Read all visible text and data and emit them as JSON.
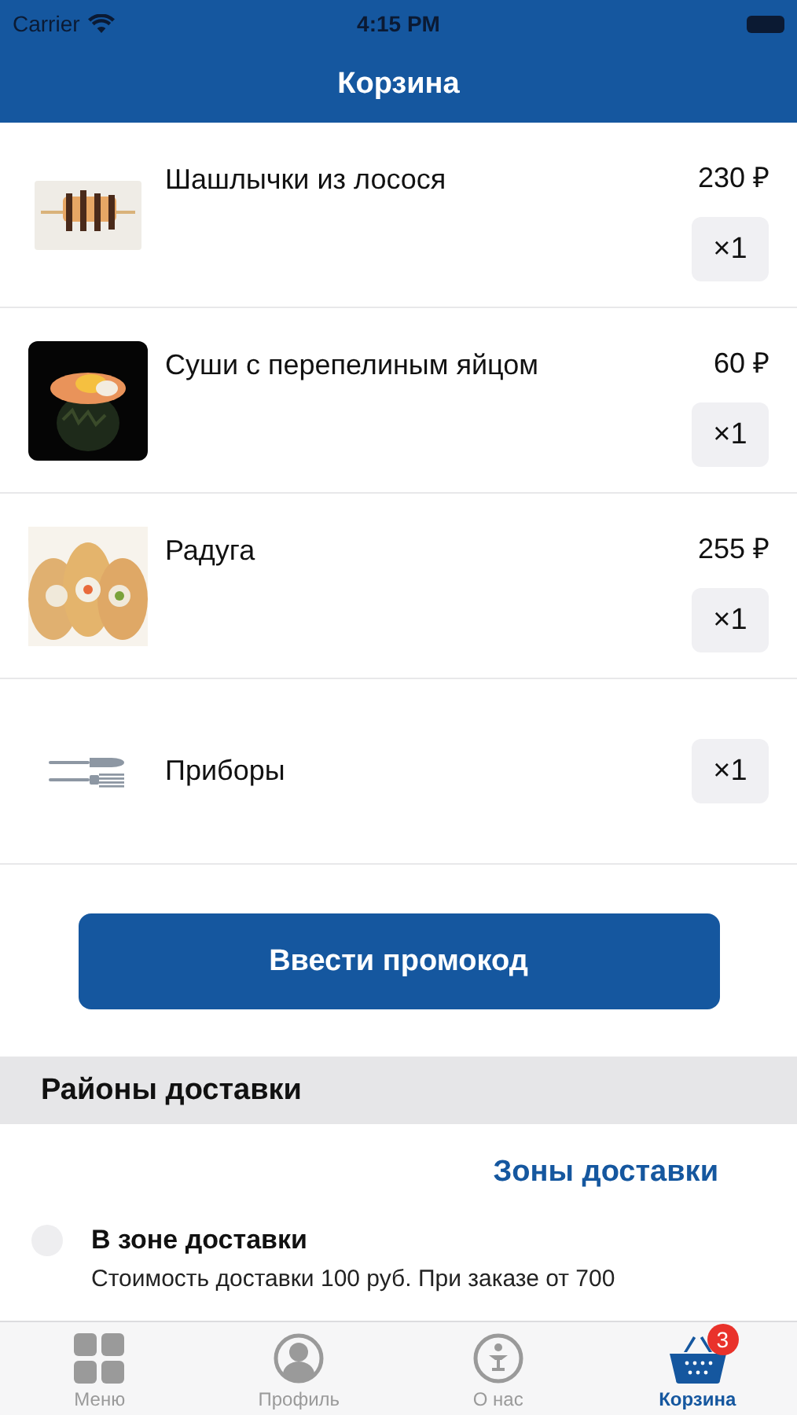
{
  "status_bar": {
    "carrier": "Carrier",
    "time": "4:15 PM"
  },
  "nav": {
    "title": "Корзина"
  },
  "cart_items": [
    {
      "kind": "product",
      "name": "Шашлычки из лосося",
      "price": "230 ₽",
      "quantity": "×1"
    },
    {
      "kind": "product",
      "name": "Суши с перепелиным яйцом",
      "price": "60 ₽",
      "quantity": "×1"
    },
    {
      "kind": "product",
      "name": "Радуга",
      "price": "255 ₽",
      "quantity": "×1"
    },
    {
      "kind": "cutlery",
      "name": "Приборы",
      "quantity": "×1"
    }
  ],
  "promo_button": "Ввести промокод",
  "delivery": {
    "header": "Районы доставки",
    "zones_link": "Зоны доставки",
    "options": [
      {
        "title": "В зоне доставки",
        "description": "Стоимость доставки 100 руб. При заказе от 700",
        "selected": false
      }
    ]
  },
  "tab_bar": [
    {
      "kind": "menu",
      "label": "Меню",
      "selected": false
    },
    {
      "kind": "profile",
      "label": "Профиль",
      "selected": false
    },
    {
      "kind": "about",
      "label": "О нас",
      "selected": false
    },
    {
      "kind": "cart",
      "label": "Корзина",
      "selected": true,
      "badge": "3"
    }
  ]
}
